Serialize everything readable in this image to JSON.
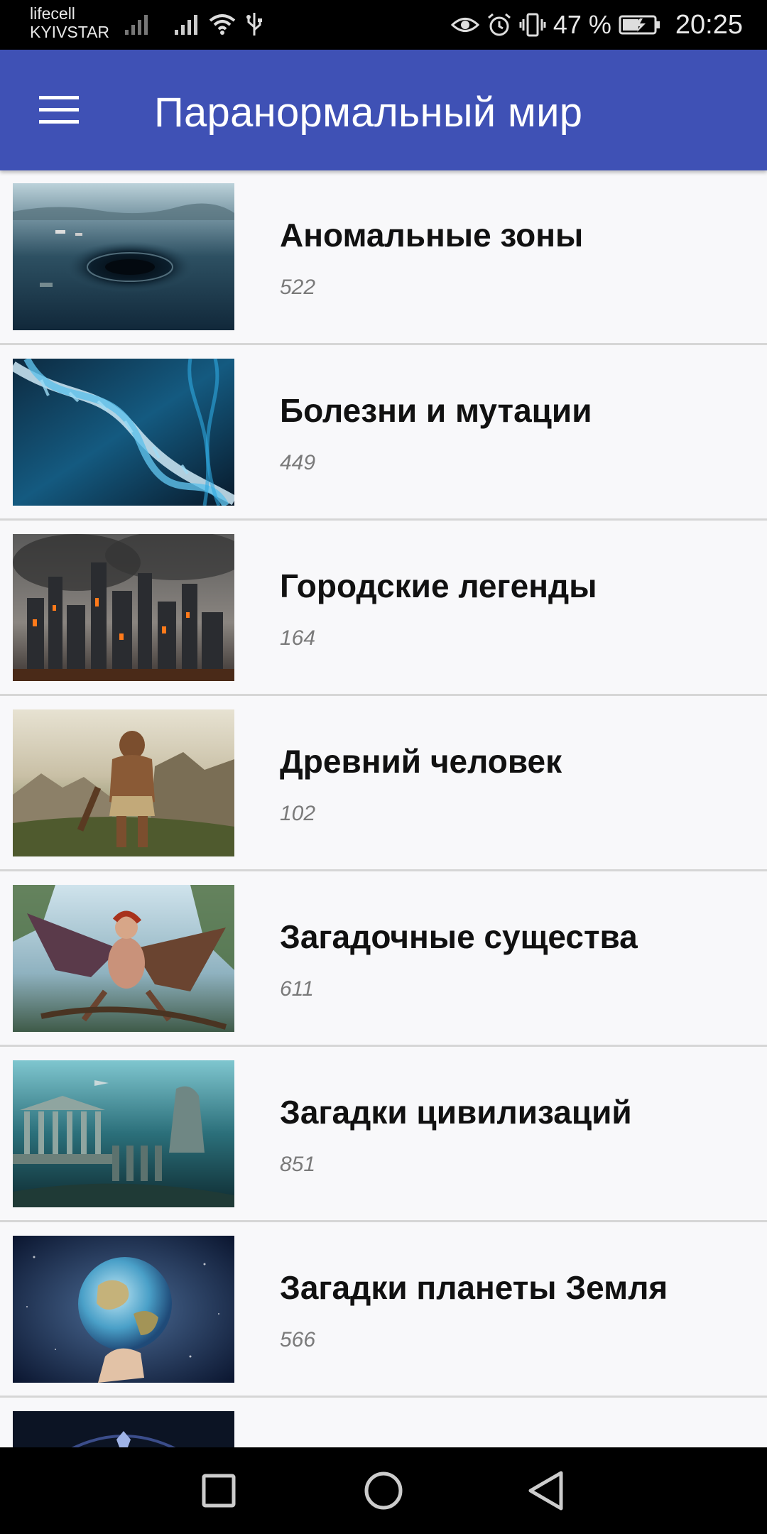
{
  "status_bar": {
    "carrier_line1": "lifecell",
    "carrier_line2": "KYIVSTAR",
    "battery_percent": "47 %",
    "time": "20:25",
    "icons": [
      "signal-icon",
      "signal-icon",
      "wifi-icon",
      "usb-icon",
      "eye-icon",
      "alarm-icon",
      "vibrate-icon",
      "battery-charging-icon"
    ]
  },
  "app_bar": {
    "title": "Паранормальный мир",
    "menu_icon": "hamburger-menu-icon",
    "color": "#3f51b5"
  },
  "categories": [
    {
      "title": "Аномальные зоны",
      "count": "522",
      "thumb": "whirlpool-sea-image"
    },
    {
      "title": "Болезни и мутации",
      "count": "449",
      "thumb": "dna-helix-image"
    },
    {
      "title": "Городские легенды",
      "count": "164",
      "thumb": "burning-city-image"
    },
    {
      "title": "Древний человек",
      "count": "102",
      "thumb": "caveman-image"
    },
    {
      "title": "Загадочные существа",
      "count": "611",
      "thumb": "winged-creature-image"
    },
    {
      "title": "Загадки цивилизаций",
      "count": "851",
      "thumb": "underwater-ruins-image"
    },
    {
      "title": "Загадки планеты Земля",
      "count": "566",
      "thumb": "earth-in-hand-image"
    }
  ],
  "nav_bar": {
    "buttons": [
      "recent-apps-icon",
      "home-icon",
      "back-icon"
    ]
  }
}
